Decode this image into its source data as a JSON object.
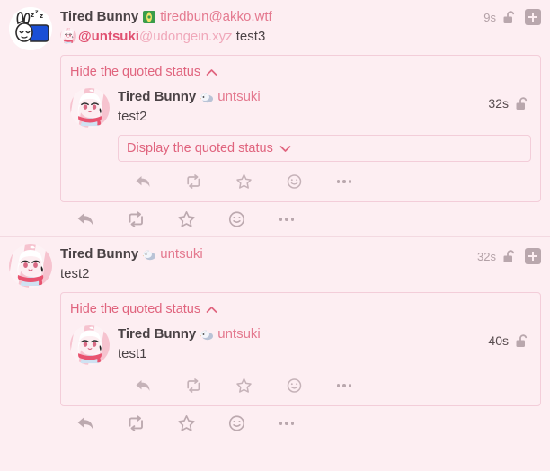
{
  "app": {
    "theme_background": "#fdeef2",
    "accent_color": "#e0647e",
    "muted_color": "#b9a7ad"
  },
  "icons": {
    "reply": "reply-arrow-icon",
    "boost": "repeat-boost-icon",
    "favourite": "star-icon",
    "react": "emoji-smiley-icon",
    "more": "ellipsis-icon",
    "visibility": "unlocked-padlock-icon",
    "expand": "plus-box-icon",
    "chevron_up": "chevron-up-icon",
    "chevron_down": "chevron-down-icon"
  },
  "statuses": [
    {
      "avatar_name": "sleeping-bunny-avatar",
      "display_name": "Tired Bunny",
      "name_emoji": "green-badge-emoji",
      "acct": "tiredbun@akko.wtf",
      "timestamp": "9s",
      "visibility_label": "unlocked",
      "content": {
        "mention_user": "@untsuki",
        "mention_domain": "@udongein.xyz",
        "text": "test3"
      },
      "quote": {
        "toggle_label": "Hide the quoted status",
        "toggle_state": "expanded",
        "avatar_name": "white-haired-character-avatar",
        "display_name": "Tired Bunny",
        "name_emoji": "bird-emoji",
        "acct": "untsuki",
        "timestamp": "32s",
        "content": "test2",
        "nested_toggle_label": "Display the quoted status",
        "nested_toggle_state": "collapsed"
      }
    },
    {
      "avatar_name": "white-haired-character-avatar",
      "display_name": "Tired Bunny",
      "name_emoji": "bird-emoji",
      "acct": "untsuki",
      "timestamp": "32s",
      "visibility_label": "unlocked",
      "content": {
        "text": "test2"
      },
      "quote": {
        "toggle_label": "Hide the quoted status",
        "toggle_state": "expanded",
        "avatar_name": "white-haired-character-avatar",
        "display_name": "Tired Bunny",
        "name_emoji": "bird-emoji",
        "acct": "untsuki",
        "timestamp": "40s",
        "content": "test1"
      }
    }
  ]
}
